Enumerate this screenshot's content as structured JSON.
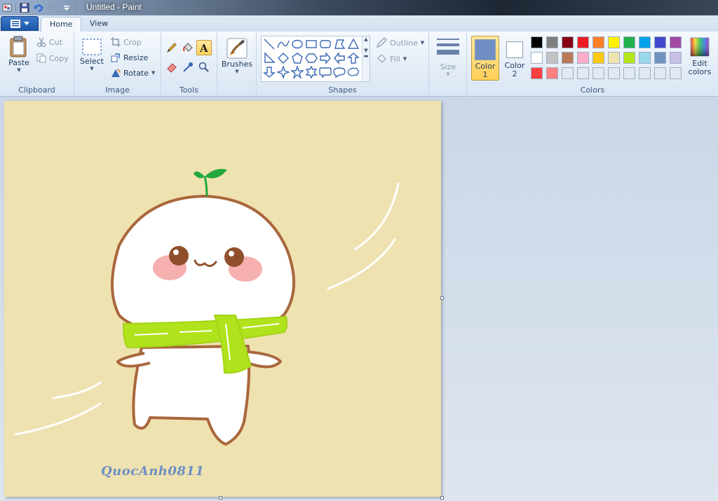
{
  "window": {
    "title": "Untitled - Paint"
  },
  "tabs": [
    {
      "label": "Home",
      "active": true
    },
    {
      "label": "View",
      "active": false
    }
  ],
  "clipboard": {
    "group_label": "Clipboard",
    "paste": "Paste",
    "cut": "Cut",
    "copy": "Copy"
  },
  "image": {
    "group_label": "Image",
    "select": "Select",
    "crop": "Crop",
    "resize": "Resize",
    "rotate": "Rotate"
  },
  "tools": {
    "group_label": "Tools",
    "items": [
      "pencil-icon",
      "fill-bucket-icon",
      "text-icon",
      "eraser-icon",
      "color-picker-icon",
      "magnifier-icon"
    ],
    "selected": "text-icon"
  },
  "brushes": {
    "label": "Brushes"
  },
  "shapes": {
    "group_label": "Shapes",
    "outline": "Outline",
    "fill": "Fill"
  },
  "size": {
    "label": "Size"
  },
  "colors": {
    "group_label": "Colors",
    "color1_label": "Color",
    "color1_num": "1",
    "color1_value": "#6f8fc4",
    "color2_label": "Color",
    "color2_num": "2",
    "color2_value": "#ffffff",
    "edit_label_1": "Edit",
    "edit_label_2": "colors",
    "palette_row1": [
      "#000000",
      "#7f7f7f",
      "#880015",
      "#ed1c24",
      "#ff7f27",
      "#fff200",
      "#22b14c",
      "#00a2e8",
      "#3f48cc",
      "#a349a4"
    ],
    "palette_row2": [
      "#ffffff",
      "#c3c3c3",
      "#b97a57",
      "#ffaec9",
      "#ffc90e",
      "#efe4b0",
      "#b5e61d",
      "#99d9ea",
      "#7092be",
      "#c8bfe7"
    ],
    "palette_row3": [
      "#ff4040",
      "#ff8080",
      "#e3e9f2",
      "#e3e9f2",
      "#e3e9f2",
      "#e3e9f2",
      "#e3e9f2",
      "#e3e9f2",
      "#e3e9f2",
      "#e3e9f2"
    ]
  },
  "canvas": {
    "background": "#efe2b1",
    "signature": "QuocAnh0811"
  }
}
